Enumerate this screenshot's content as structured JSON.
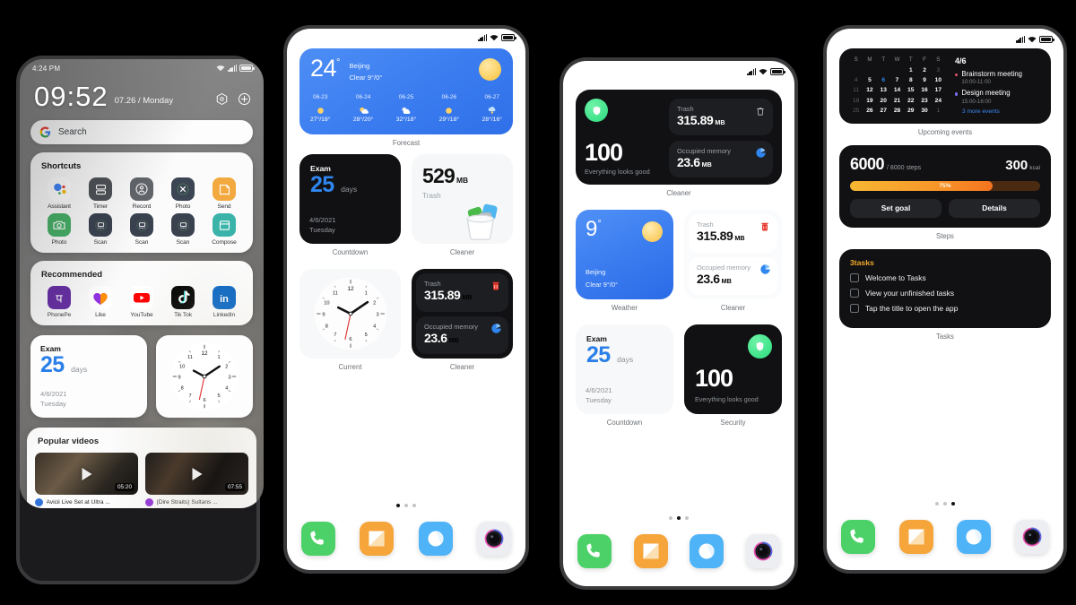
{
  "scene": {
    "background": "#000000",
    "description": "Four smartphone mockups showing MIUI-style home screens with widgets"
  },
  "phone1": {
    "status": {
      "time": "4:24 PM",
      "icons": [
        "wifi-icon",
        "signal-icon",
        "battery-icon"
      ]
    },
    "clock": {
      "time": "09:52",
      "date": "07.26 / Monday",
      "icons": [
        "settings-hex-icon",
        "add-circle-icon"
      ]
    },
    "search": {
      "placeholder": "Search",
      "engine_icon": "google-g-icon"
    },
    "shortcuts": {
      "title": "Shortcuts",
      "items": [
        {
          "label": "Assistant",
          "icon": "google-assistant-icon",
          "color": "#ffffff"
        },
        {
          "label": "Timer",
          "icon": "timer-icon",
          "color": "#4f5257"
        },
        {
          "label": "Record",
          "icon": "record-person-icon",
          "color": "#63666b"
        },
        {
          "label": "Photo",
          "icon": "photo-close-icon",
          "color": "#3b4553"
        },
        {
          "label": "Send",
          "icon": "send-note-icon",
          "color": "#f2a93f"
        },
        {
          "label": "Photo",
          "icon": "camera-icon",
          "color": "#46b066"
        },
        {
          "label": "Scan",
          "icon": "scan-icon",
          "color": "#3a4250"
        },
        {
          "label": "Scan",
          "icon": "scan-icon",
          "color": "#3a4250"
        },
        {
          "label": "Scan",
          "icon": "scan-icon",
          "color": "#3a4250"
        },
        {
          "label": "Compose",
          "icon": "compose-icon",
          "color": "#3ab3a8"
        }
      ]
    },
    "recommended": {
      "title": "Recommended",
      "items": [
        {
          "label": "PhonePe",
          "icon": "phonepe-icon",
          "color": "#5f259f"
        },
        {
          "label": "Like",
          "icon": "likee-heart-icon",
          "color": "#ffffff"
        },
        {
          "label": "YouTube",
          "icon": "youtube-icon",
          "color": "#ffffff"
        },
        {
          "label": "Tik Tok",
          "icon": "tiktok-icon",
          "color": "#010101"
        },
        {
          "label": "LinkedIn",
          "icon": "linkedin-icon",
          "color": "#0a66c2"
        }
      ]
    },
    "countdown": {
      "label": "Exam",
      "value": "25",
      "unit": "days",
      "date": "4/6/2021",
      "weekday": "Tuesday"
    },
    "clock_widget": {
      "name": "analog-clock",
      "hour": 10,
      "minute": 10,
      "second": 35
    },
    "videos": {
      "title": "Popular videos",
      "items": [
        {
          "title": "Avicii Live Set at Ultra ...",
          "duration": "05:20",
          "channel_color": "#2a6fd8"
        },
        {
          "title": "(Dire Straits) Sultans ...",
          "duration": "07:55",
          "channel_color": "#8f2ad6"
        }
      ]
    }
  },
  "phone2": {
    "status": {
      "icons": [
        "signal-icon",
        "wifi-icon",
        "battery-icon"
      ]
    },
    "forecast": {
      "caption": "Forecast",
      "temp": "24",
      "degree": "°",
      "city": "Beijing",
      "condition": "Clear  9°/0°",
      "icon": "sun-icon",
      "days": [
        {
          "date": "06-23",
          "icon": "sun-icon",
          "temps": "27°/18°"
        },
        {
          "date": "06-24",
          "icon": "partly-cloudy-icon",
          "temps": "28°/20°"
        },
        {
          "date": "06-25",
          "icon": "cloudy-icon",
          "temps": "32°/18°"
        },
        {
          "date": "06-26",
          "icon": "sun-icon",
          "temps": "29°/18°"
        },
        {
          "date": "06-27",
          "icon": "thunderstorm-icon",
          "temps": "28°/16°"
        }
      ]
    },
    "countdown": {
      "caption": "Countdown",
      "label": "Exam",
      "value": "25",
      "unit": "days",
      "date": "4/6/2021",
      "weekday": "Tuesday"
    },
    "cleaner_light": {
      "caption": "Cleaner",
      "value": "529",
      "unit": "MB",
      "sub": "Trash",
      "icon": "trash-bin-art-icon"
    },
    "clock": {
      "caption": "Current",
      "hour": 10,
      "minute": 10,
      "second": 35
    },
    "cleaner_dark": {
      "caption": "Cleaner",
      "rows": [
        {
          "label": "Trash",
          "value": "315.89",
          "unit": "MB",
          "icon": "trash-red-icon"
        },
        {
          "label": "Occupied memory",
          "value": "23.6",
          "unit": "MB",
          "icon": "pie-chart-icon"
        }
      ]
    },
    "dots": {
      "count": 3,
      "active": 0
    },
    "dock": [
      {
        "name": "phone-app-icon",
        "color": "#4cd168"
      },
      {
        "name": "messages-app-icon",
        "color": "#f5a53a"
      },
      {
        "name": "browser-app-icon",
        "color": "#4fb3f7"
      },
      {
        "name": "camera-app-icon",
        "color": "#eceef1"
      }
    ]
  },
  "phone3": {
    "status": {
      "icons": [
        "signal-icon",
        "wifi-icon",
        "battery-icon"
      ]
    },
    "cleaner_wide": {
      "caption": "Cleaner",
      "score": "100",
      "score_sub": "Everything looks good",
      "badge_icon": "shield-icon",
      "rows": [
        {
          "label": "Trash",
          "value": "315.89",
          "unit": "MB",
          "icon": "trash-outline-icon"
        },
        {
          "label": "Occupied memory",
          "value": "23.6",
          "unit": "MB",
          "icon": "pie-chart-icon"
        }
      ]
    },
    "weather": {
      "caption": "Weather",
      "temp": "9",
      "degree": "°",
      "city": "Beijing",
      "condition": "Clear  9°/0°",
      "icon": "sun-icon"
    },
    "cleaner_light": {
      "caption": "Cleaner",
      "rows": [
        {
          "label": "Trash",
          "value": "315.89",
          "unit": "MB",
          "icon": "trash-red-icon"
        },
        {
          "label": "Occupied memory",
          "value": "23.6",
          "unit": "MB",
          "icon": "pie-chart-icon"
        }
      ]
    },
    "countdown": {
      "caption": "Countdown",
      "label": "Exam",
      "value": "25",
      "unit": "days",
      "date": "4/6/2021",
      "weekday": "Tuesday"
    },
    "security": {
      "caption": "Security",
      "score": "100",
      "sub": "Everything looks good",
      "badge_icon": "shield-icon"
    },
    "dots": {
      "count": 3,
      "active": 1
    },
    "dock": [
      {
        "name": "phone-app-icon",
        "color": "#4cd168"
      },
      {
        "name": "messages-app-icon",
        "color": "#f5a53a"
      },
      {
        "name": "browser-app-icon",
        "color": "#4fb3f7"
      },
      {
        "name": "camera-app-icon",
        "color": "#eceef1"
      }
    ]
  },
  "phone4": {
    "status": {
      "icons": [
        "signal-icon",
        "wifi-icon",
        "battery-icon"
      ]
    },
    "calendar": {
      "caption": "Upcoming events",
      "weekdays": [
        "S",
        "M",
        "T",
        "W",
        "T",
        "F",
        "S"
      ],
      "weeks": [
        [
          "",
          "",
          "",
          "",
          "1",
          "2",
          "3"
        ],
        [
          "4",
          "5",
          "6",
          "7",
          "8",
          "9",
          "10"
        ],
        [
          "11",
          "12",
          "13",
          "14",
          "15",
          "16",
          "17"
        ],
        [
          "18",
          "19",
          "20",
          "21",
          "22",
          "23",
          "24"
        ],
        [
          "25",
          "26",
          "27",
          "28",
          "29",
          "30",
          "1"
        ]
      ],
      "dim": [
        "3",
        "4",
        "11",
        "18",
        "25",
        "1"
      ],
      "selected": "6",
      "date_label": "4/6",
      "events": [
        {
          "title": "Brainstorm meeting",
          "time": "10:00-11:00",
          "dot": "#e2536a"
        },
        {
          "title": "Design meeting",
          "time": "15:00-16:00",
          "dot": "#7a6ef0"
        }
      ],
      "more": "3 more events"
    },
    "steps": {
      "caption": "Steps",
      "value": "6000",
      "goal": "/ 8000 steps",
      "kcal": "300",
      "kcal_unit": "kcal",
      "progress_label": "75%",
      "progress": 75,
      "buttons": [
        "Set goal",
        "Details"
      ]
    },
    "tasks": {
      "caption": "Tasks",
      "title": "3tasks",
      "items": [
        "Welcome to Tasks",
        "View your unfinished tasks",
        "Tap the title to open the app"
      ]
    },
    "dots": {
      "count": 3,
      "active": 2
    },
    "dock": [
      {
        "name": "phone-app-icon",
        "color": "#4cd168"
      },
      {
        "name": "messages-app-icon",
        "color": "#f5a53a"
      },
      {
        "name": "browser-app-icon",
        "color": "#4fb3f7"
      },
      {
        "name": "camera-app-icon",
        "color": "#eceef1"
      }
    ]
  }
}
